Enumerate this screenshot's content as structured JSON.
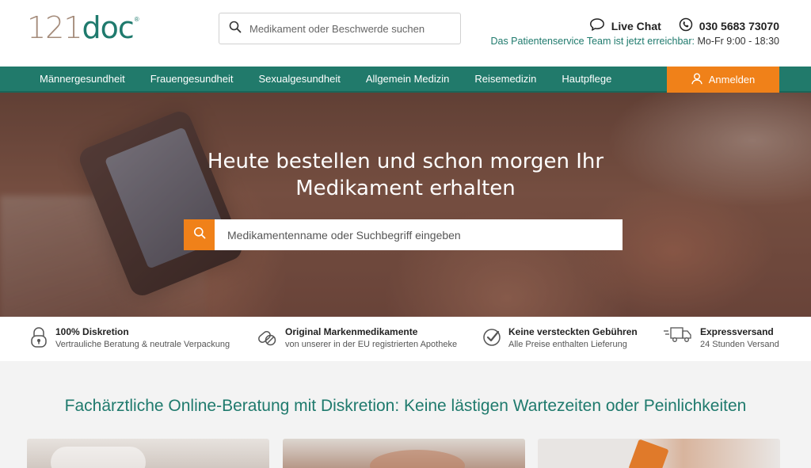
{
  "header": {
    "logo": {
      "number": "121",
      "word": "doc",
      "mark": "®"
    },
    "search": {
      "placeholder": "Medikament oder Beschwerde suchen",
      "icon": "search-icon"
    },
    "live_chat": {
      "label": "Live Chat",
      "icon": "chat-bubble-icon"
    },
    "phone": {
      "label": "030 5683 73070",
      "icon": "phone-icon"
    },
    "service": {
      "text": "Das Patientenservice Team ist jetzt erreichbar:",
      "hours": "Mo-Fr 9:00 - 18:30"
    }
  },
  "nav": {
    "items": [
      {
        "label": "Männergesundheit"
      },
      {
        "label": "Frauengesundheit"
      },
      {
        "label": "Sexualgesundheit"
      },
      {
        "label": "Allgemein Medizin"
      },
      {
        "label": "Reisemedizin"
      },
      {
        "label": "Hautpflege"
      }
    ],
    "login": {
      "label": "Anmelden",
      "icon": "user-icon"
    }
  },
  "hero": {
    "headline_line1": "Heute bestellen und schon morgen Ihr",
    "headline_line2": "Medikament erhalten",
    "search": {
      "placeholder": "Medikamentenname oder Suchbegriff eingeben",
      "icon": "search-icon"
    }
  },
  "features": [
    {
      "title": "100% Diskretion",
      "sub": "Vertrauliche Beratung & neutrale Verpackung",
      "icon": "lock-icon"
    },
    {
      "title": "Original Markenmedikamente",
      "sub": "von unserer in der EU registrierten Apotheke",
      "icon": "pills-icon"
    },
    {
      "title": "Keine versteckten Gebühren",
      "sub": "Alle Preise enthalten Lieferung",
      "icon": "checkmark-badge-icon"
    },
    {
      "title": "Expressversand",
      "sub": "24 Stunden Versand",
      "icon": "truck-icon"
    }
  ],
  "section": {
    "title": "Fachärztliche Online-Beratung mit Diskretion: Keine lästigen Wartezeiten oder Peinlichkeiten"
  },
  "colors": {
    "brand_green": "#217a6b",
    "accent_orange": "#f08119",
    "logo_brown": "#a48b7a"
  }
}
